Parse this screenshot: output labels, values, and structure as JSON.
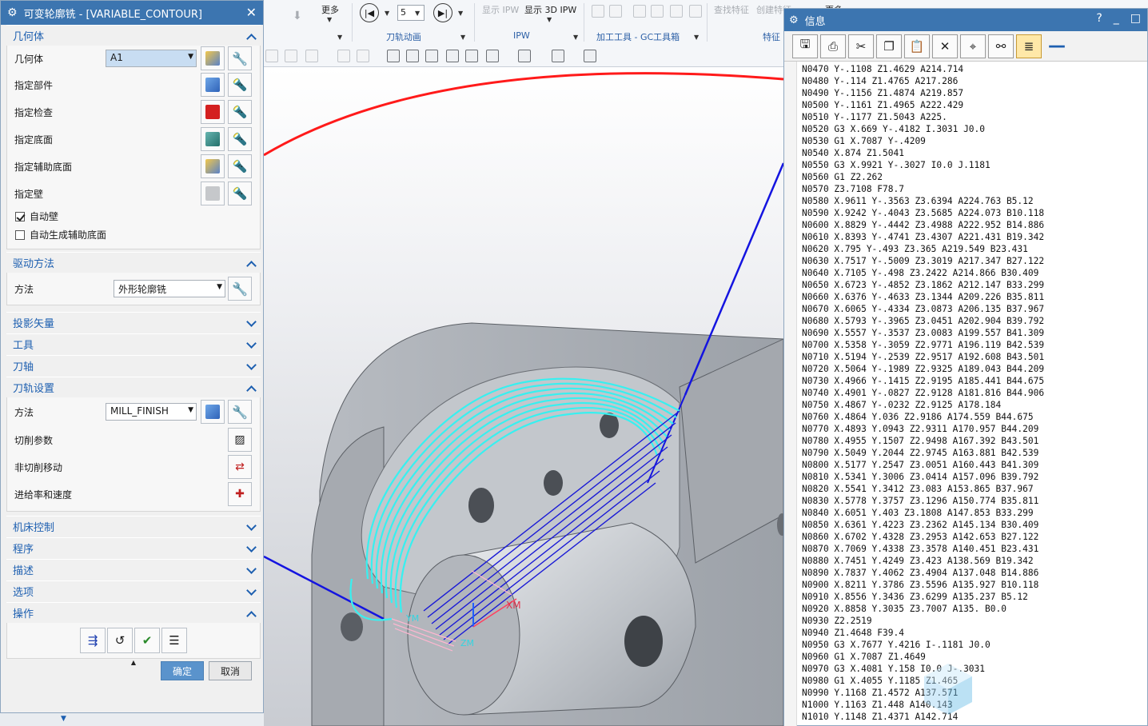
{
  "dialog": {
    "title": "可变轮廓铣 - [VARIABLE_CONTOUR]",
    "sections": {
      "geometry": "几何体",
      "drive": "驱动方法",
      "projection": "投影矢量",
      "tool": "工具",
      "axis": "刀轴",
      "path_settings": "刀轨设置",
      "machine_control": "机床控制",
      "program": "程序",
      "description": "描述",
      "options": "选项",
      "actions": "操作"
    },
    "geometry": {
      "label": "几何体",
      "value": "A1",
      "specify_part": "指定部件",
      "specify_check": "指定检查",
      "specify_floor": "指定底面",
      "specify_aux_floor": "指定辅助底面",
      "specify_wall": "指定壁",
      "auto_wall": "自动壁",
      "auto_aux_floor": "自动生成辅助底面",
      "auto_wall_checked": true,
      "auto_aux_floor_checked": false
    },
    "drive": {
      "label": "方法",
      "value": "外形轮廓铣"
    },
    "path": {
      "method_label": "方法",
      "method_value": "MILL_FINISH",
      "cut_params": "切削参数",
      "non_cut": "非切削移动",
      "feeds": "进给率和速度"
    },
    "ok": "确定",
    "cancel": "取消"
  },
  "ribbon": {
    "more_1": "更多",
    "more_2": "更多",
    "step_value": "5",
    "group_toolpath_anim": "刀轨动画",
    "group_ipw": "IPW",
    "group_gc": "加工工具 - GC工具箱",
    "group_feature": "特征",
    "show_ipw": "显示 IPW",
    "show_3d_ipw": "显示 3D IPW",
    "find_feature": "查找特征",
    "create_feature": "创建特征"
  },
  "viewport": {
    "xm_label": "XM",
    "ym_label": "YM",
    "zm_label": "ZM",
    "colors": {
      "background_top": "#f4f5f7",
      "background_bottom": "#c9ccd2",
      "part_gray": "#b8bcc2",
      "cyan_path": "#38f0f0",
      "blue_path": "#1414e0",
      "red_arc": "#ff1a1a"
    }
  },
  "info": {
    "title": "信息",
    "help": "?",
    "minimize": "_",
    "maximize": "□",
    "toolbar": [
      "save-icon",
      "print-icon",
      "cut-icon",
      "copy-icon",
      "paste-icon",
      "delete-icon",
      "find-icon",
      "binoculars-icon",
      "wrap-icon",
      "minus-icon"
    ],
    "lines": [
      "N0470 Y-.1108 Z1.4629 A214.714",
      "N0480 Y-.114 Z1.4765 A217.286",
      "N0490 Y-.1156 Z1.4874 A219.857",
      "N0500 Y-.1161 Z1.4965 A222.429",
      "N0510 Y-.1177 Z1.5043 A225.",
      "N0520 G3 X.669 Y-.4182 I.3031 J0.0",
      "N0530 G1 X.7087 Y-.4209",
      "N0540 X.874 Z1.5041",
      "N0550 G3 X.9921 Y-.3027 I0.0 J.1181",
      "N0560 G1 Z2.262",
      "N0570 Z3.7108 F78.7",
      "N0580 X.9611 Y-.3563 Z3.6394 A224.763 B5.12",
      "N0590 X.9242 Y-.4043 Z3.5685 A224.073 B10.118",
      "N0600 X.8829 Y-.4442 Z3.4988 A222.952 B14.886",
      "N0610 X.8393 Y-.4741 Z3.4307 A221.431 B19.342",
      "N0620 X.795 Y-.493 Z3.365 A219.549 B23.431",
      "N0630 X.7517 Y-.5009 Z3.3019 A217.347 B27.122",
      "N0640 X.7105 Y-.498 Z3.2422 A214.866 B30.409",
      "N0650 X.6723 Y-.4852 Z3.1862 A212.147 B33.299",
      "N0660 X.6376 Y-.4633 Z3.1344 A209.226 B35.811",
      "N0670 X.6065 Y-.4334 Z3.0873 A206.135 B37.967",
      "N0680 X.5793 Y-.3965 Z3.0451 A202.904 B39.792",
      "N0690 X.5557 Y-.3537 Z3.0083 A199.557 B41.309",
      "N0700 X.5358 Y-.3059 Z2.9771 A196.119 B42.539",
      "N0710 X.5194 Y-.2539 Z2.9517 A192.608 B43.501",
      "N0720 X.5064 Y-.1989 Z2.9325 A189.043 B44.209",
      "N0730 X.4966 Y-.1415 Z2.9195 A185.441 B44.675",
      "N0740 X.4901 Y-.0827 Z2.9128 A181.816 B44.906",
      "N0750 X.4867 Y-.0232 Z2.9125 A178.184",
      "N0760 X.4864 Y.036 Z2.9186 A174.559 B44.675",
      "N0770 X.4893 Y.0943 Z2.9311 A170.957 B44.209",
      "N0780 X.4955 Y.1507 Z2.9498 A167.392 B43.501",
      "N0790 X.5049 Y.2044 Z2.9745 A163.881 B42.539",
      "N0800 X.5177 Y.2547 Z3.0051 A160.443 B41.309",
      "N0810 X.5341 Y.3006 Z3.0414 A157.096 B39.792",
      "N0820 X.5541 Y.3412 Z3.083 A153.865 B37.967",
      "N0830 X.5778 Y.3757 Z3.1296 A150.774 B35.811",
      "N0840 X.6051 Y.403 Z3.1808 A147.853 B33.299",
      "N0850 X.6361 Y.4223 Z3.2362 A145.134 B30.409",
      "N0860 X.6702 Y.4328 Z3.2953 A142.653 B27.122",
      "N0870 X.7069 Y.4338 Z3.3578 A140.451 B23.431",
      "N0880 X.7451 Y.4249 Z3.423 A138.569 B19.342",
      "N0890 X.7837 Y.4062 Z3.4904 A137.048 B14.886",
      "N0900 X.8211 Y.3786 Z3.5596 A135.927 B10.118",
      "N0910 X.8556 Y.3436 Z3.6299 A135.237 B5.12",
      "N0920 X.8858 Y.3035 Z3.7007 A135. B0.0",
      "N0930 Z2.2519",
      "N0940 Z1.4648 F39.4",
      "N0950 G3 X.7677 Y.4216 I-.1181 J0.0",
      "N0960 G1 X.7087 Z1.4649",
      "N0970 G3 X.4081 Y.158 I0.0 J-.3031",
      "N0980 G1 X.4055 Y.1185 Z1.465",
      "N0990 Y.1168 Z1.4572 A137.571",
      "N1000 Y.1163 Z1.448 A140.143",
      "N1010 Y.1148 Z1.4371 A142.714"
    ]
  }
}
